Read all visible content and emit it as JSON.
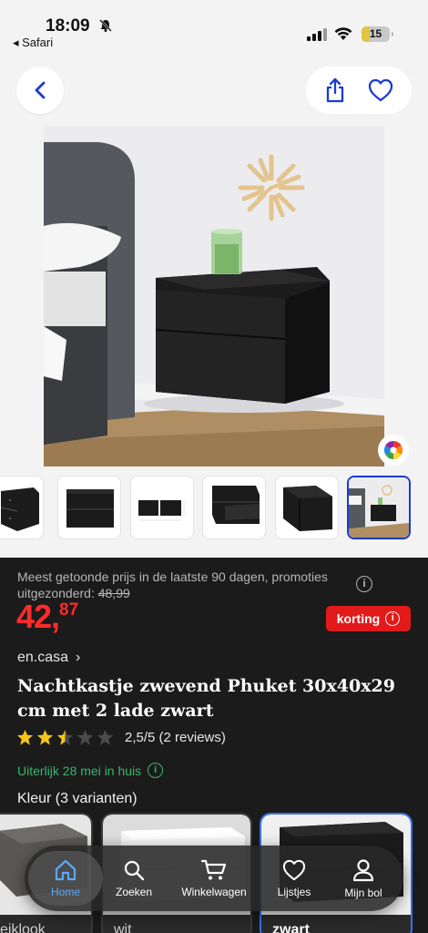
{
  "status_bar": {
    "time": "18:09",
    "back_app": "Safari",
    "battery": "15"
  },
  "header": {
    "back_icon": "chevron-left-icon",
    "share_icon": "share-icon",
    "wishlist_icon": "heart-icon"
  },
  "colors": {
    "accent_blue": "#1a3bd6",
    "price_red": "#ff2b2b",
    "korting_red": "#e21a1a",
    "delivery_green": "#3ab66a"
  },
  "product": {
    "price_note": "Meest getoonde prijs in de laatste 90 dagen, promoties uitgezonderd:",
    "previous_price": "48,99",
    "price_main": "42,",
    "price_cents": "87",
    "korting_label": "korting",
    "brand": "en.casa",
    "title": "Nachtkastje zwevend Phuket 30x40x29 cm met 2 lade zwart",
    "rating_stars": 2.5,
    "rating_text": "2,5/5 (2 reviews)",
    "delivery": "Uiterlijk 28 mei in huis",
    "color_label": "Kleur (3 varianten)"
  },
  "variants": [
    {
      "label": "eiklook"
    },
    {
      "label": "wit"
    },
    {
      "label": "zwart"
    }
  ],
  "bottom_nav": [
    {
      "label": "Home",
      "icon": "home-icon"
    },
    {
      "label": "Zoeken",
      "icon": "search-icon"
    },
    {
      "label": "Winkelwagen",
      "icon": "cart-icon"
    },
    {
      "label": "Lijstjes",
      "icon": "heart-icon"
    },
    {
      "label": "Mijn bol",
      "icon": "user-icon"
    }
  ]
}
